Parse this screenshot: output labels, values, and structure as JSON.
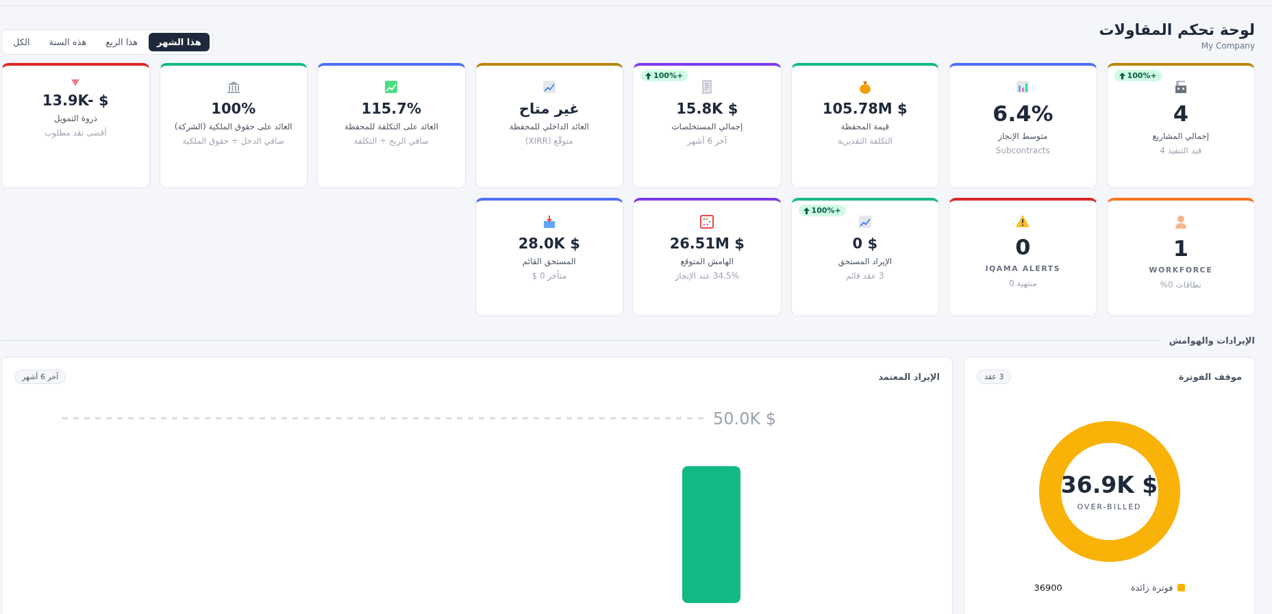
{
  "header": {
    "title": "لوحة تحكم المقاولات",
    "subtitle": "My Company"
  },
  "tabs": [
    {
      "label": "هذا الشهر",
      "selected": true
    },
    {
      "label": "هذا الربع",
      "selected": false
    },
    {
      "label": "هذه السنة",
      "selected": false
    },
    {
      "label": "الكل",
      "selected": false
    }
  ],
  "kpi_rows": [
    [
      {
        "kind": "big",
        "value": "4",
        "label": "إجمالي المشاريع",
        "note": "قيد التنفيذ 4",
        "badge": "100%+",
        "color": "#b8860b"
      },
      {
        "kind": "big",
        "value": "6.4%",
        "label": "متوسط الإنجاز",
        "note": "Subcontracts",
        "color": "#4f6ef7"
      },
      {
        "kind": "normal",
        "value": "105.78M $",
        "label": "قيمة المحفظة",
        "note": "التكلفة التقديرية",
        "color": "#10b981"
      },
      {
        "kind": "normal",
        "value": "15.8K $",
        "label": "إجمالي المستخلصات",
        "note": "آخر 6 أشهر",
        "badge": "100%+",
        "color": "#7c3aed"
      },
      {
        "kind": "normal",
        "value": "غير متاح",
        "label": "العائد الداخلي للمحفظة",
        "note": "متوقّع (XIRR)",
        "color": "#b8860b"
      },
      {
        "kind": "normal",
        "value": "115.7%",
        "label": "العائد على التكلفة للمحفظة",
        "note": "صافي الربح ÷ التكلفة",
        "color": "#4f6ef7"
      },
      {
        "kind": "normal",
        "value": "100%",
        "label": "العائد على حقوق الملكية (الشركة)",
        "note": "صافي الدخل ÷ حقوق الملكية",
        "color": "#10b981"
      },
      {
        "kind": "normal",
        "value": "13.9K- $",
        "label": "ذروة التمويل",
        "note": "أقصى نقد مطلوب",
        "color": "#dc2626"
      }
    ],
    [
      {
        "kind": "big",
        "value": "1",
        "label": "WORKFORCE",
        "note": "نطاقات 0%",
        "color": "#f97316"
      },
      {
        "kind": "big",
        "value": "0",
        "label": "IQAMA ALERTS",
        "note": "منتهية 0",
        "color": "#dc2626"
      },
      {
        "kind": "normal",
        "value": "0 $",
        "label": "الإيراد المستحق",
        "note": "3 عقد قائم",
        "badge": "100%+",
        "color": "#10b981"
      },
      {
        "kind": "normal",
        "value": "26.51M $",
        "label": "الهامش المتوقع",
        "note": "34.5% عند الإنجاز",
        "color": "#7c3aed"
      },
      {
        "kind": "normal",
        "value": "28.0K $",
        "label": "المستحق القائم",
        "note": "متأخر 0 $",
        "color": "#4f6ef7"
      }
    ]
  ],
  "section": {
    "title": "الإيرادات والهوامش"
  },
  "revenue_card": {
    "title": "الإيراد المعتمد",
    "pill": "آخر 6 أشهر",
    "gridline_label": "50.0K $"
  },
  "billing_card": {
    "title": "موقف الفوترة",
    "pill": "3 عقد",
    "center_value": "36.9K $",
    "center_label": "OVER-BILLED",
    "legend": [
      {
        "label": "فوترة زائدة",
        "value": "36900",
        "color": "#f9b208"
      }
    ]
  }
}
